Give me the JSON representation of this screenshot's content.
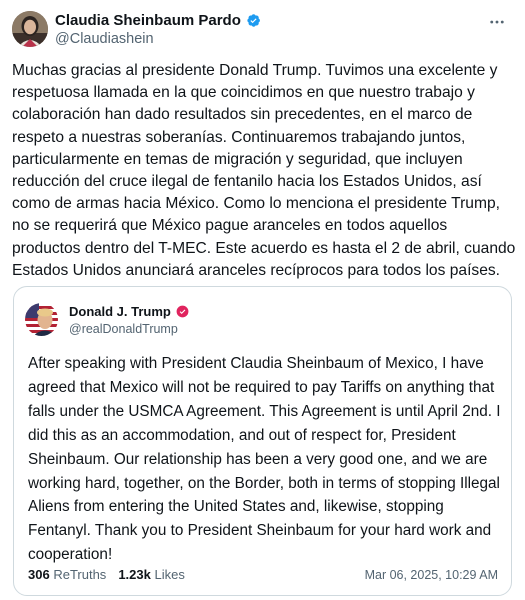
{
  "tweet": {
    "author": {
      "name": "Claudia Sheinbaum Pardo",
      "handle": "@Claudiashein",
      "verified": true,
      "verified_color": "#1d9bf0"
    },
    "more_icon": "more-horizontal-icon",
    "text": "Muchas gracias al presidente Donald Trump. Tuvimos una excelente y respetuosa llamada en la que coincidimos en que nuestro trabajo y colaboración han dado resultados sin precedentes, en el marco de respeto a nuestras soberanías. Continuaremos trabajando juntos, particularmente en temas de migración y seguridad, que incluyen reducción del cruce ilegal de fentanilo hacia los Estados Unidos, así como de armas hacia México. Como lo menciona el presidente Trump, no se requerirá que México pague aranceles en todos aquellos productos dentro del T-MEC. Este acuerdo es hasta el 2 de abril, cuando Estados Unidos anunciará aranceles recíprocos para todos los países."
  },
  "quoted_post": {
    "author": {
      "name": "Donald J. Trump",
      "handle": "@realDonaldTrump",
      "verified": true,
      "verified_color": "#e0245e"
    },
    "text": "After speaking with President Claudia Sheinbaum of Mexico, I have agreed that Mexico will not be required to pay Tariffs on anything that falls under the USMCA Agreement. This Agreement is until April 2nd. I did this as an accommodation, and out of respect for, President Sheinbaum. Our relationship has been a very good one, and we are working hard, together, on the Border, both in terms of stopping Illegal Aliens from entering the United States and, likewise, stopping Fentanyl. Thank you to President Sheinbaum for your hard work and cooperation!",
    "stats": {
      "retruths_count": "306",
      "retruths_label": "ReTruths",
      "likes_count": "1.23k",
      "likes_label": "Likes"
    },
    "date": "Mar 06, 2025, 10:29 AM"
  },
  "colors": {
    "text_primary": "#0f1419",
    "text_secondary": "#536471",
    "border": "#cfd9de"
  }
}
